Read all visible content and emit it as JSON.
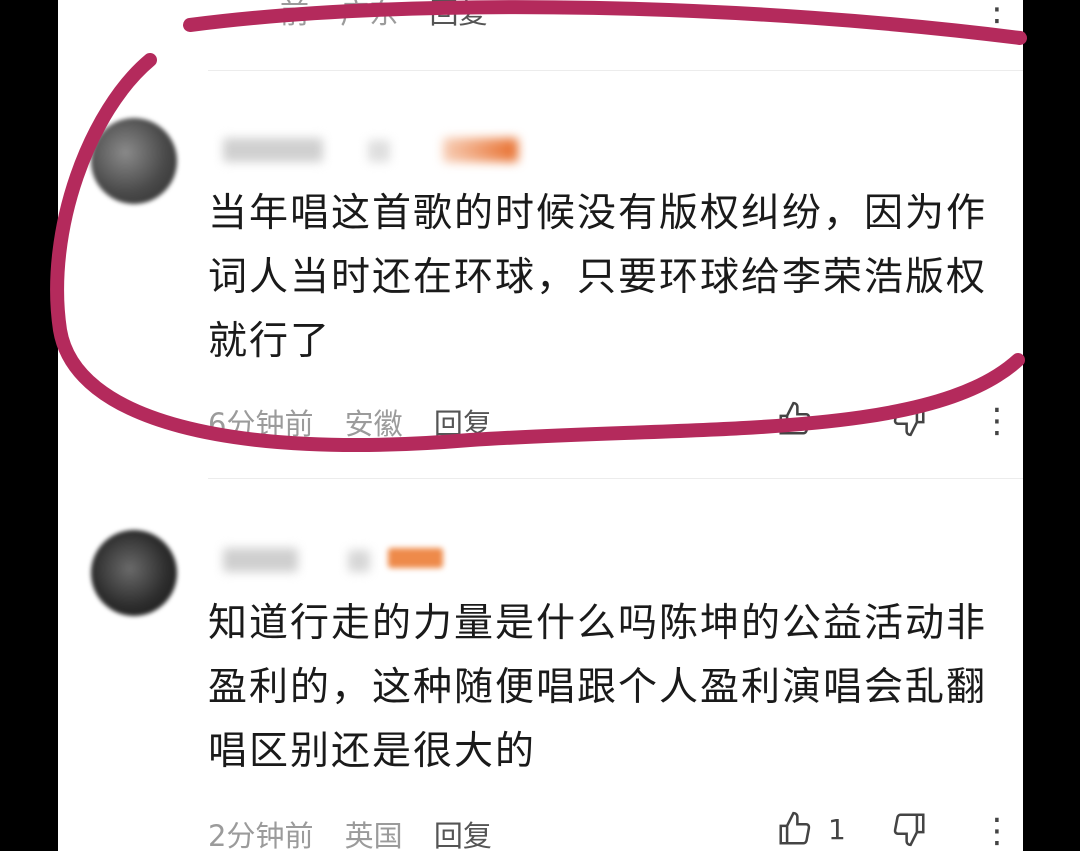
{
  "top_comment": {
    "time_fragment": "前",
    "location": "广东",
    "reply_label": "回复"
  },
  "comment_1": {
    "text_lines": [
      "当年唱这首歌的时候没有版权纠纷，因为作",
      "词人当时还在环球，只要环球给李荣浩版权",
      "就行了"
    ],
    "time": "6分钟前",
    "location": "安徽",
    "reply_label": "回复"
  },
  "comment_2": {
    "text_lines": [
      "知道行走的力量是什么吗陈坤的公益活动非",
      "盈利的，这种随便唱跟个人盈利演唱会乱翻",
      "唱区别还是很大的"
    ],
    "time": "2分钟前",
    "location": "英国",
    "reply_label": "回复",
    "like_count": "1"
  },
  "icons": {
    "like": "thumbs-up-icon",
    "dislike": "thumbs-down-icon",
    "more": "more-vertical-icon"
  },
  "colors": {
    "annotation_stroke": "#b42a5c",
    "text": "#1a1a1a",
    "meta": "#9b9b9b"
  }
}
